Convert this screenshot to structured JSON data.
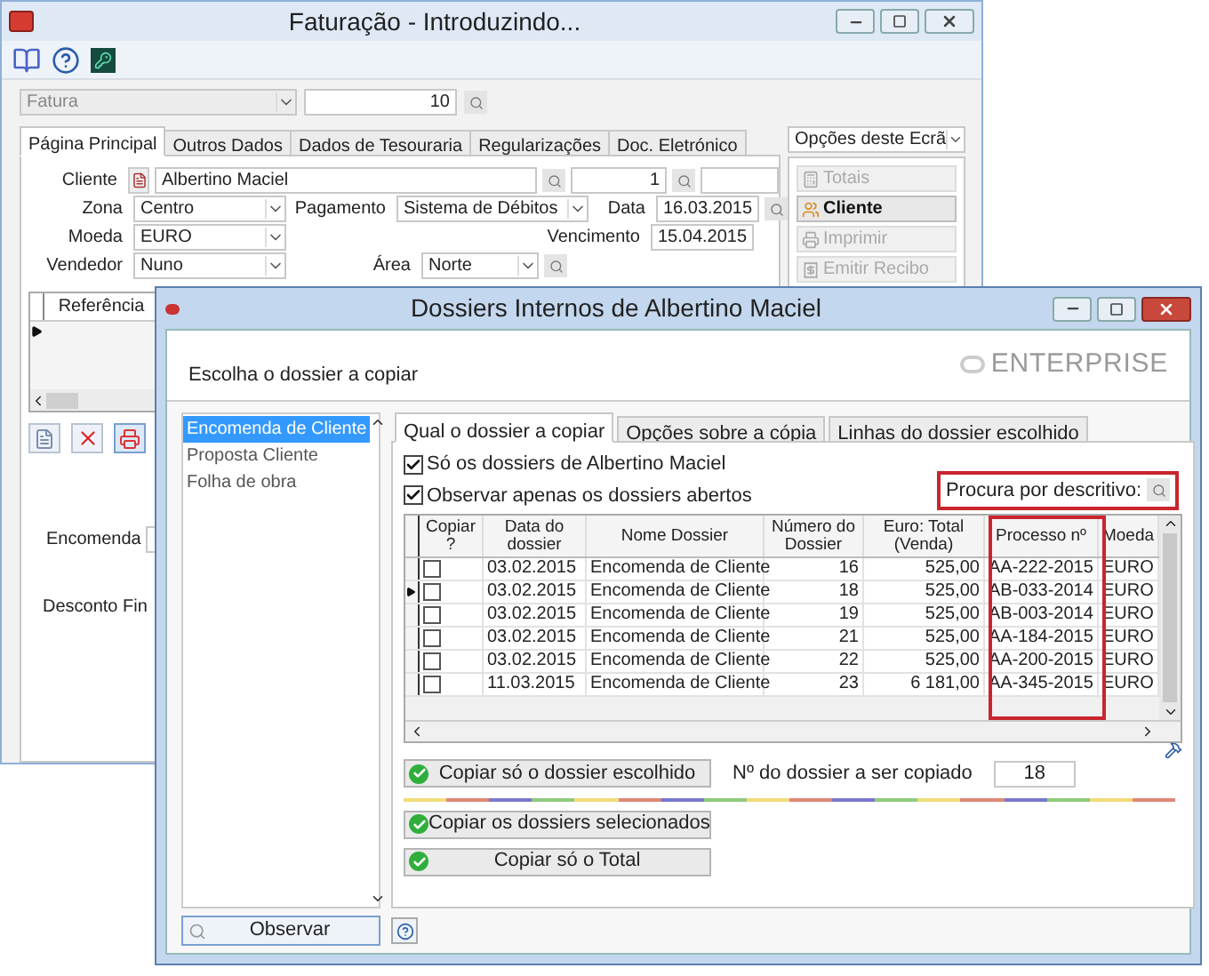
{
  "main_window": {
    "title": "Faturação - Introduzindo...",
    "document_type": "Fatura",
    "document_number": "10",
    "tabs": [
      {
        "label": "Página Principal",
        "selected": true
      },
      {
        "label": "Outros Dados",
        "selected": false
      },
      {
        "label": "Dados de Tesouraria",
        "selected": false
      },
      {
        "label": "Regularizações",
        "selected": false
      },
      {
        "label": "Doc. Eletrónico",
        "selected": false
      }
    ],
    "cliente": {
      "label": "Cliente",
      "value": "Albertino Maciel",
      "number": "1"
    },
    "zona": {
      "label": "Zona",
      "value": "Centro"
    },
    "pagamento": {
      "label": "Pagamento",
      "value": "Sistema de Débitos"
    },
    "data": {
      "label": "Data",
      "value": "16.03.2015"
    },
    "moeda": {
      "label": "Moeda",
      "value": "EURO"
    },
    "vencimento": {
      "label": "Vencimento",
      "value": "15.04.2015"
    },
    "vendedor": {
      "label": "Vendedor",
      "value": "Nuno"
    },
    "area": {
      "label": "Área",
      "value": "Norte"
    },
    "grid_columns": [
      "Referência"
    ],
    "encomenda_label": "Encomenda",
    "desconto_label": "Desconto Fin",
    "options": {
      "title": "Opções deste Ecrã",
      "buttons": [
        {
          "label": "Totais",
          "disabled": true
        },
        {
          "label": "Cliente",
          "disabled": false
        },
        {
          "label": "Imprimir",
          "disabled": true
        },
        {
          "label": "Emitir Recibo",
          "disabled": true
        }
      ]
    }
  },
  "dialog": {
    "title": "Dossiers Internos de Albertino Maciel",
    "heading": "Escolha o dossier a copiar",
    "logo": "ENTERPRISE",
    "dossier_types": [
      {
        "label": "Encomenda de Cliente",
        "selected": true
      },
      {
        "label": "Proposta Cliente",
        "selected": false
      },
      {
        "label": "Folha de obra",
        "selected": false
      }
    ],
    "tabs": [
      {
        "label": "Qual o dossier a copiar",
        "selected": true
      },
      {
        "label": "Opções sobre a cópia",
        "selected": false
      },
      {
        "label": "Linhas do dossier escolhido",
        "selected": false
      }
    ],
    "filters": [
      {
        "label": "Só os dossiers de Albertino Maciel",
        "checked": true
      },
      {
        "label": "Observar apenas os dossiers abertos",
        "checked": true
      }
    ],
    "search_label": "Procura por descritivo:",
    "table": {
      "checkbox_column": "Copiar ?",
      "columns": [
        "Data do dossier",
        "Nome Dossier",
        "Número do Dossier",
        "Euro: Total (Venda)",
        "Processo nº",
        "Moeda"
      ],
      "rows": [
        {
          "checked": false,
          "selected": false,
          "cells": [
            "03.02.2015",
            "Encomenda de Cliente",
            "16",
            "525,00",
            "AA-222-2015",
            "EURO"
          ]
        },
        {
          "checked": false,
          "selected": true,
          "cells": [
            "03.02.2015",
            "Encomenda de Cliente",
            "18",
            "525,00",
            "AB-033-2014",
            "EURO"
          ]
        },
        {
          "checked": false,
          "selected": false,
          "cells": [
            "03.02.2015",
            "Encomenda de Cliente",
            "19",
            "525,00",
            "AB-003-2014",
            "EURO"
          ]
        },
        {
          "checked": false,
          "selected": false,
          "cells": [
            "03.02.2015",
            "Encomenda de Cliente",
            "21",
            "525,00",
            "AA-184-2015",
            "EURO"
          ]
        },
        {
          "checked": false,
          "selected": false,
          "cells": [
            "03.02.2015",
            "Encomenda de Cliente",
            "22",
            "525,00",
            "AA-200-2015",
            "EURO"
          ]
        },
        {
          "checked": false,
          "selected": false,
          "cells": [
            "11.03.2015",
            "Encomenda de Cliente",
            "23",
            "6 181,00",
            "AA-345-2015",
            "EURO"
          ]
        }
      ]
    },
    "copy_chosen_button": "Copiar só o dossier escolhido",
    "dossier_number_label": "Nº do dossier a ser copiado",
    "dossier_number": "18",
    "copy_selected_button": "Copiar os dossiers selecionados",
    "copy_total_button": "Copiar só o Total",
    "observe_button": "Observar"
  }
}
